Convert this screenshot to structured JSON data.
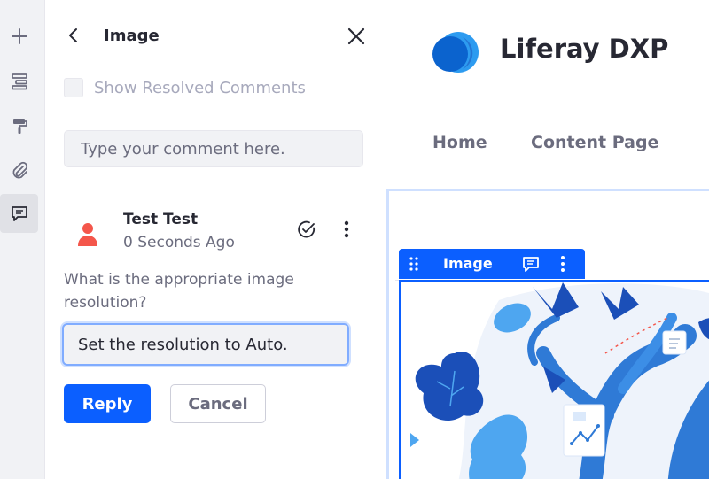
{
  "rail": {
    "items": [
      {
        "name": "add-icon"
      },
      {
        "name": "page-structure-icon"
      },
      {
        "name": "paint-brush-icon"
      },
      {
        "name": "paperclip-icon"
      },
      {
        "name": "comments-icon",
        "active": true
      }
    ]
  },
  "panel": {
    "title": "Image",
    "show_resolved_label": "Show Resolved Comments",
    "comment_placeholder": "Type your comment here."
  },
  "comment": {
    "author": "Test Test",
    "timestamp": "0 Seconds Ago",
    "text": "What is the appropriate image resolution?",
    "reply_value": "Set the resolution to Auto.",
    "reply_label": "Reply",
    "cancel_label": "Cancel"
  },
  "preview": {
    "site_name": "Liferay DXP",
    "nav": [
      "Home",
      "Content Page"
    ],
    "fragment_label": "Image"
  },
  "colors": {
    "primary": "#0b5fff",
    "avatar": "#f4564b",
    "text_secondary": "#6b6c7e"
  }
}
